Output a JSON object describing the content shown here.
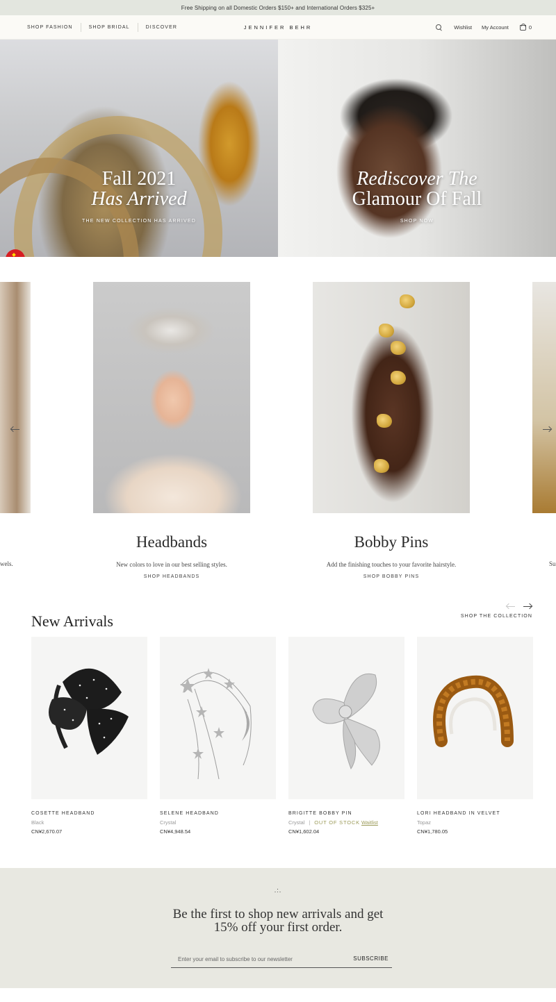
{
  "announcement": {
    "text": "Free Shipping on all Domestic Orders $150+ and International Orders $325+"
  },
  "header": {
    "nav": [
      "Shop Fashion",
      "Shop Bridal",
      "Discover"
    ],
    "logo": "JENNIFER BEHR",
    "wishlist": "Wishlist",
    "account": "My Account",
    "cart_count": "0"
  },
  "hero": {
    "left": {
      "title_line1": "Fall 2021",
      "title_line2": "Has Arrived",
      "link": "The New Collection Has Arrived"
    },
    "right": {
      "title_line1": "Rediscover The",
      "title_line2": "Glamour Of Fall",
      "link": "Shop Now"
    }
  },
  "categories": {
    "left_edge_text": "wels.",
    "right_edge_text": "Su",
    "items": [
      {
        "title": "Headbands",
        "description": "New colors to love in our best selling styles.",
        "link": "Shop Headbands"
      },
      {
        "title": "Bobby Pins",
        "description": "Add the finishing touches to your favorite hairstyle.",
        "link": "Shop Bobby Pins"
      }
    ]
  },
  "new_arrivals": {
    "title": "New Arrivals",
    "shop_link": "Shop The Collection",
    "products": [
      {
        "name": "Cosette Headband",
        "variant": "Black",
        "price": "CN¥2,670.07"
      },
      {
        "name": "Selene Headband",
        "variant": "Crystal",
        "price": "CN¥4,948.54"
      },
      {
        "name": "Brigitte Bobby Pin",
        "variant": "Crystal",
        "status": "Out of Stock",
        "waitlist": "Waitlist",
        "price": "CN¥1,602.04"
      },
      {
        "name": "Lori Headband in Velvet",
        "variant": "Topaz",
        "price": "CN¥1,780.05"
      }
    ]
  },
  "newsletter": {
    "mark": ".:.",
    "title_line1": "Be the first to shop new arrivals and get",
    "title_line2": "15% off your first order.",
    "placeholder": "Enter your email to subscribe to our newsletter",
    "submit": "Subscribe"
  }
}
